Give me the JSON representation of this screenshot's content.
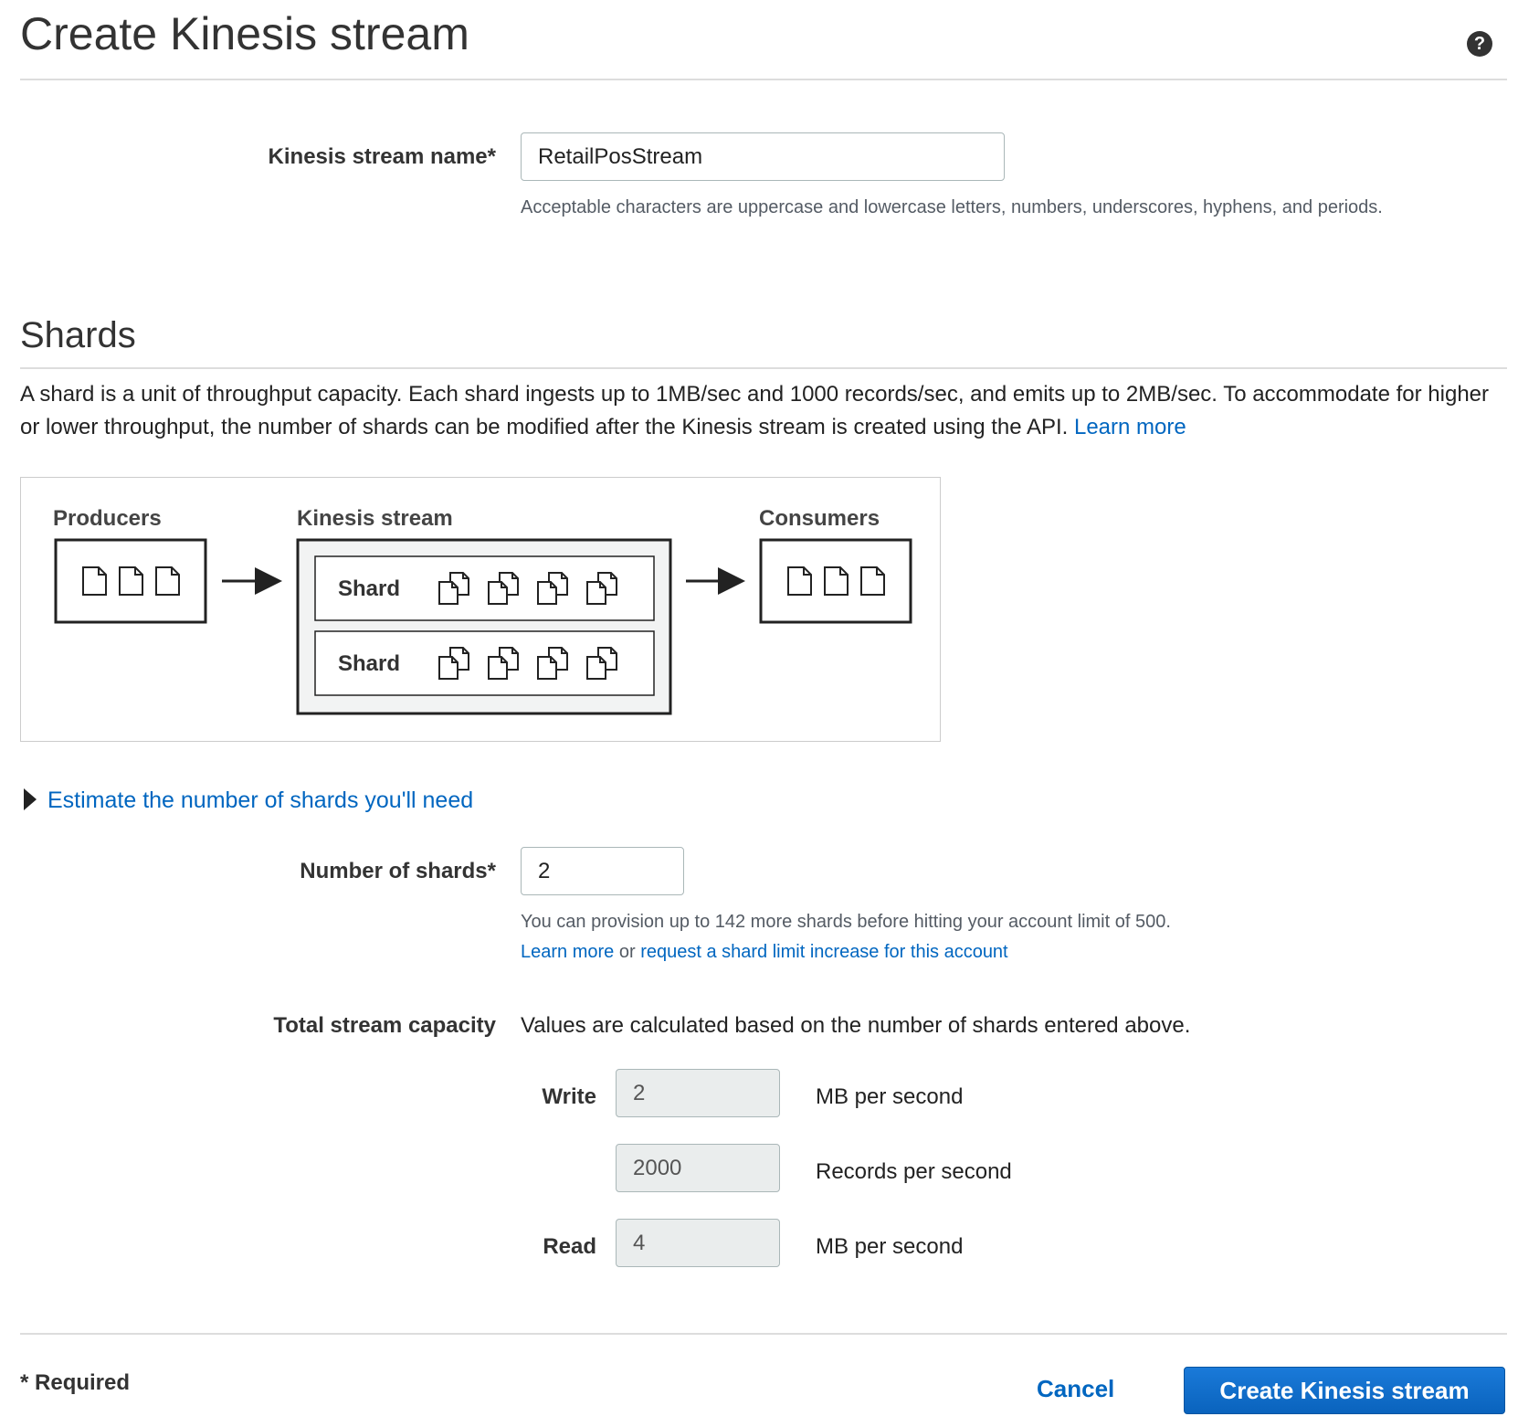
{
  "header": {
    "title": "Create Kinesis stream",
    "help_icon": "?"
  },
  "stream_name": {
    "label": "Kinesis stream name*",
    "value": "RetailPosStream",
    "hint": "Acceptable characters are uppercase and lowercase letters, numbers, underscores, hyphens, and periods."
  },
  "shards_section": {
    "title": "Shards",
    "description": "A shard is a unit of throughput capacity. Each shard ingests up to 1MB/sec and 1000 records/sec, and emits up to 2MB/sec. To accommodate for higher or lower throughput, the number of shards can be modified after the Kinesis stream is created using the API.",
    "learn_more": "Learn more"
  },
  "diagram": {
    "producers_label": "Producers",
    "stream_label": "Kinesis stream",
    "consumers_label": "Consumers",
    "shard_labels": [
      "Shard",
      "Shard"
    ]
  },
  "estimate": {
    "label": "Estimate the number of shards you'll need"
  },
  "num_shards": {
    "label": "Number of shards*",
    "value": "2",
    "hint": "You can provision up to 142 more shards before hitting your account limit of 500.",
    "learn_more": "Learn more",
    "or_text": "or",
    "request_link": "request a shard limit increase for this account"
  },
  "capacity": {
    "label": "Total stream capacity",
    "description": "Values are calculated based on the number of shards entered above.",
    "write_label": "Write",
    "write_mb": "2",
    "write_mb_unit": "MB per second",
    "write_records": "2000",
    "write_records_unit": "Records per second",
    "read_label": "Read",
    "read_mb": "4",
    "read_mb_unit": "MB per second"
  },
  "footer": {
    "required_note": "* Required",
    "cancel_label": "Cancel",
    "create_label": "Create Kinesis stream"
  }
}
